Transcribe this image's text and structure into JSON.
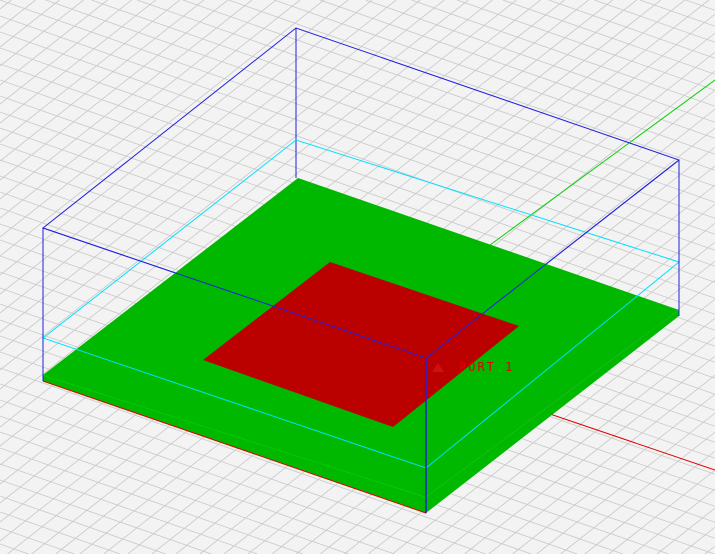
{
  "viewport": {
    "port_label": "PORT 1",
    "colors": {
      "background": "#f3f3f3",
      "grid": "#c8c8c8",
      "substrate": "#00b800",
      "patch": "#bb0000",
      "box_outline": "#2020e0",
      "mid_outline": "#00e0ff",
      "axis_y": "#00d000",
      "axis_x": "#e00000"
    }
  }
}
